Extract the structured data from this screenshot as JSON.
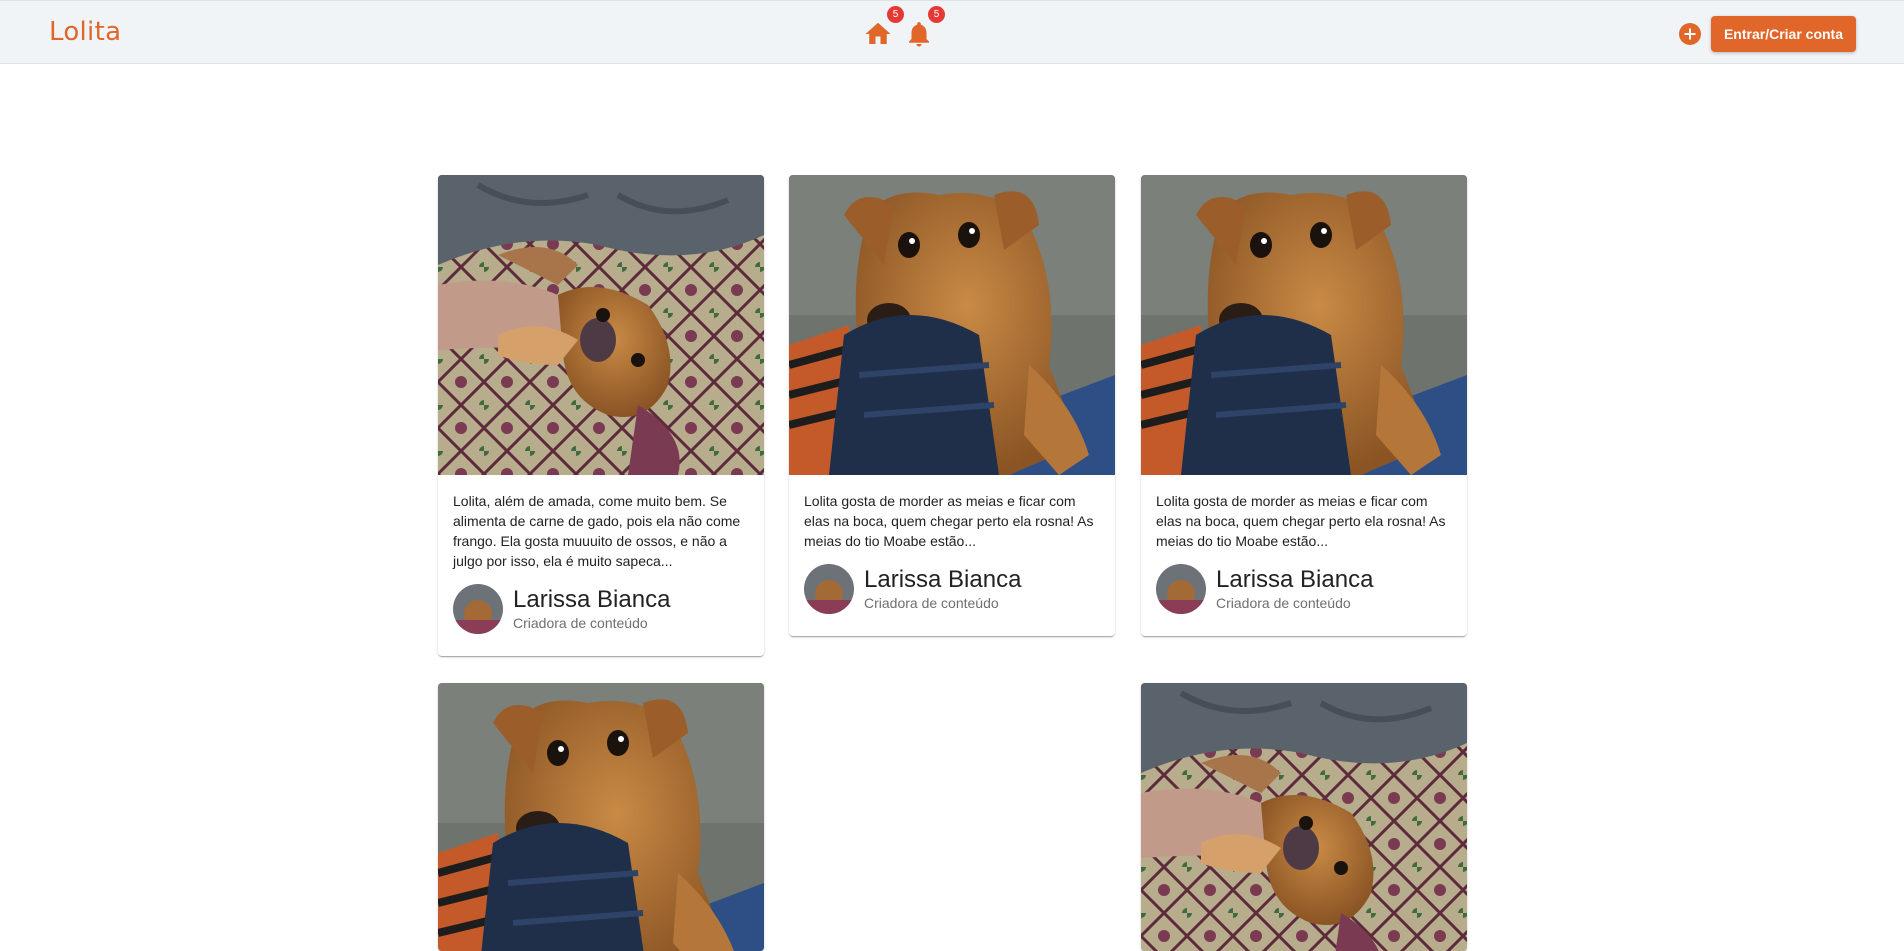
{
  "app": {
    "brand": "Lolita",
    "accent_color": "#e0662a",
    "badge_color": "#e53935"
  },
  "nav": {
    "home_icon": "home-icon",
    "home_badge": "5",
    "notifications_icon": "bell-icon",
    "notifications_badge": "5"
  },
  "header_actions": {
    "add_icon": "plus-circle-icon",
    "login_label": "Entrar/Criar conta"
  },
  "posts": [
    {
      "image": "dog-lying-on-blanket-photo",
      "text": "Lolita, além de amada, come muito bem. Se alimenta de carne de gado, pois ela não come frango. Ela gosta muuuito de ossos, e não a julgo por isso, ela é muito sapeca...",
      "author_name": "Larissa Bianca",
      "author_role": "Criadora de conteúdo"
    },
    {
      "image": "dog-with-sock-photo",
      "text": "Lolita gosta de morder as meias e ficar com elas na boca, quem chegar perto ela rosna! As meias do tio Moabe estão...",
      "author_name": "Larissa Bianca",
      "author_role": "Criadora de conteúdo"
    },
    {
      "image": "dog-with-sock-photo",
      "text": "Lolita gosta de morder as meias e ficar com elas na boca, quem chegar perto ela rosna! As meias do tio Moabe estão...",
      "author_name": "Larissa Bianca",
      "author_role": "Criadora de conteúdo"
    },
    {
      "image": "dog-with-sock-photo"
    },
    {
      "image": "dog-lying-on-blanket-photo"
    }
  ]
}
